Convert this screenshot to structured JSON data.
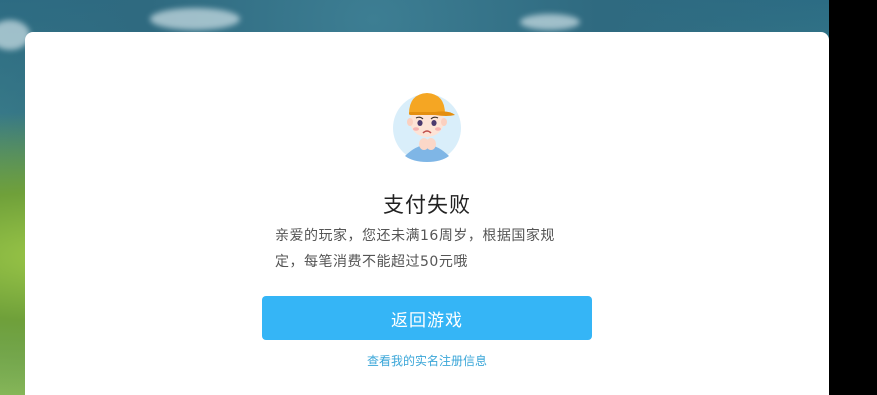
{
  "dialog": {
    "title": "支付失败",
    "message": "亲爱的玩家，您还未满16周岁，根据国家规定，每笔消费不能超过50元哦",
    "primary_button_label": "返回游戏",
    "link_label": "查看我的实名注册信息",
    "avatar_icon": "sad-child-avatar-icon"
  },
  "colors": {
    "button": "#35b5f6",
    "link": "#3aa6d8",
    "avatar_bg": "#d9eefa",
    "cap": "#f5a623"
  }
}
